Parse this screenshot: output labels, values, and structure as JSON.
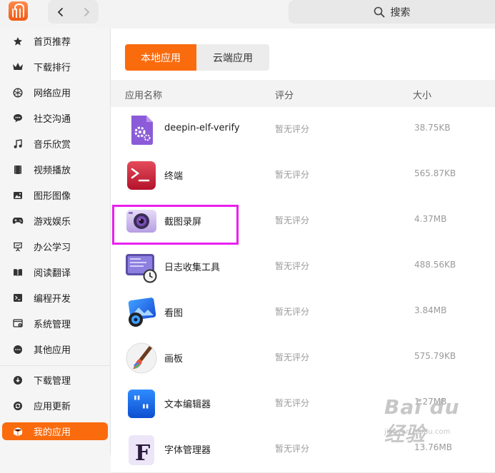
{
  "search": {
    "label": "搜索"
  },
  "sidebar": {
    "categories": [
      {
        "label": "首页推荐",
        "icon": "star-icon"
      },
      {
        "label": "下载排行",
        "icon": "crown-icon"
      },
      {
        "label": "网络应用",
        "icon": "globe-icon"
      },
      {
        "label": "社交沟通",
        "icon": "chat-icon"
      },
      {
        "label": "音乐欣赏",
        "icon": "music-note-icon"
      },
      {
        "label": "视频播放",
        "icon": "film-icon"
      },
      {
        "label": "图形图像",
        "icon": "image-icon"
      },
      {
        "label": "游戏娱乐",
        "icon": "gamepad-icon"
      },
      {
        "label": "办公学习",
        "icon": "presentation-icon"
      },
      {
        "label": "阅读翻译",
        "icon": "book-icon"
      },
      {
        "label": "编程开发",
        "icon": "terminal-icon"
      },
      {
        "label": "系统管理",
        "icon": "system-icon"
      },
      {
        "label": "其他应用",
        "icon": "more-icon"
      }
    ],
    "manage": [
      {
        "label": "下载管理",
        "icon": "download-icon"
      },
      {
        "label": "应用更新",
        "icon": "refresh-icon"
      },
      {
        "label": "我的应用",
        "icon": "box-icon",
        "active": true
      }
    ]
  },
  "tabs": {
    "local": "本地应用",
    "cloud": "云端应用"
  },
  "table": {
    "headers": {
      "name": "应用名称",
      "rating": "评分",
      "size": "大小"
    },
    "rows": [
      {
        "name": "deepin-elf-verify",
        "rating": "暂无评分",
        "size": "38.75KB",
        "icon": "settings-file-icon"
      },
      {
        "name": "终端",
        "rating": "暂无评分",
        "size": "565.87KB",
        "icon": "terminal-app-icon"
      },
      {
        "name": "截图录屏",
        "rating": "暂无评分",
        "size": "4.37MB",
        "icon": "camera-app-icon"
      },
      {
        "name": "日志收集工具",
        "rating": "暂无评分",
        "size": "488.56KB",
        "icon": "log-collector-icon"
      },
      {
        "name": "看图",
        "rating": "暂无评分",
        "size": "3.84MB",
        "icon": "image-viewer-icon"
      },
      {
        "name": "画板",
        "rating": "暂无评分",
        "size": "575.79KB",
        "icon": "draw-brush-icon"
      },
      {
        "name": "文本编辑器",
        "rating": "暂无评分",
        "size": "1.27MB",
        "icon": "text-editor-icon"
      },
      {
        "name": "字体管理器",
        "rating": "暂无评分",
        "size": "13.76MB",
        "icon": "font-manager-icon"
      }
    ]
  },
  "watermark": {
    "brand": "Bai du 经验",
    "url": "jingyan.baidu.com"
  },
  "colors": {
    "accent": "#fa6b0e",
    "highlight": "#ea1ff0"
  }
}
